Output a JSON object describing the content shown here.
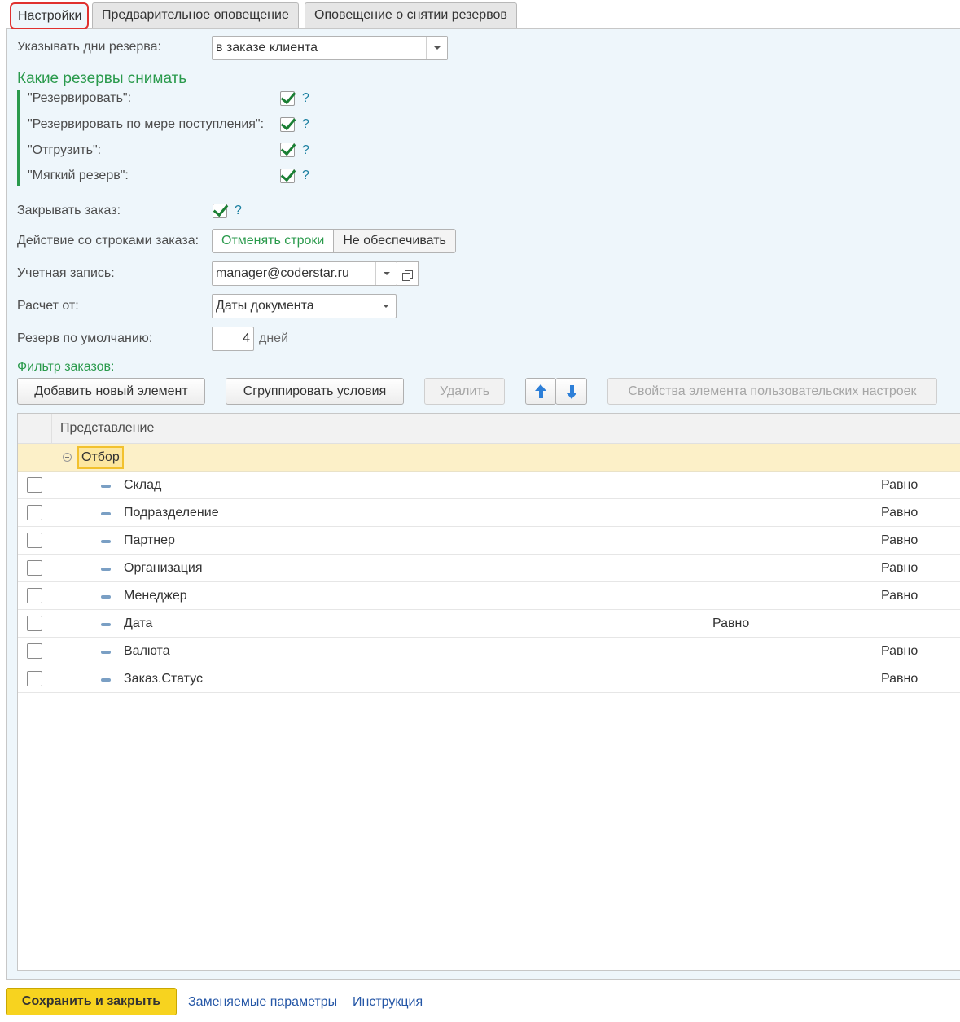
{
  "tabs": [
    "Настройки",
    "Предварительное оповещение",
    "Оповещение о снятии резервов"
  ],
  "reserve_days": {
    "label": "Указывать дни резерва:",
    "value": "в заказе клиента"
  },
  "which_reserves": {
    "title": "Какие резервы снимать",
    "items": [
      {
        "label": "\"Резервировать\":",
        "checked": true,
        "help": "?"
      },
      {
        "label": "\"Резервировать по мере поступления\":",
        "checked": true,
        "help": "?"
      },
      {
        "label": "\"Отгрузить\":",
        "checked": true,
        "help": "?"
      },
      {
        "label": "\"Мягкий резерв\":",
        "checked": true,
        "help": "?"
      }
    ]
  },
  "close_order": {
    "label": "Закрывать заказ:",
    "checked": true,
    "help": "?"
  },
  "row_action": {
    "label": "Действие со строками заказа:",
    "options": [
      "Отменять строки",
      "Не обеспечивать"
    ],
    "selected": "Отменять строки"
  },
  "account": {
    "label": "Учетная запись:",
    "value": "manager@coderstar.ru"
  },
  "calc_from": {
    "label": "Расчет от:",
    "value": "Даты документа"
  },
  "default_reserve": {
    "label": "Резерв по умолчанию:",
    "value": "4",
    "unit": "дней"
  },
  "filter": {
    "title": "Фильтр заказов:",
    "buttons": {
      "add": "Добавить новый элемент",
      "group": "Сгруппировать условия",
      "delete": "Удалить",
      "props": "Свойства элемента пользовательских настроек"
    },
    "column_header": "Представление",
    "group_name": "Отбор",
    "rows": [
      {
        "name": "Склад",
        "condition": "Равно"
      },
      {
        "name": "Подразделение",
        "condition": "Равно"
      },
      {
        "name": "Партнер",
        "condition": "Равно"
      },
      {
        "name": "Организация",
        "condition": "Равно"
      },
      {
        "name": "Менеджер",
        "condition": "Равно"
      },
      {
        "name": "Дата",
        "condition": "Равно"
      },
      {
        "name": "Валюта",
        "condition": "Равно"
      },
      {
        "name": "Заказ.Статус",
        "condition": "Равно"
      }
    ]
  },
  "footer": {
    "save": "Сохранить и закрыть",
    "links": [
      "Заменяемые параметры",
      "Инструкция"
    ]
  }
}
